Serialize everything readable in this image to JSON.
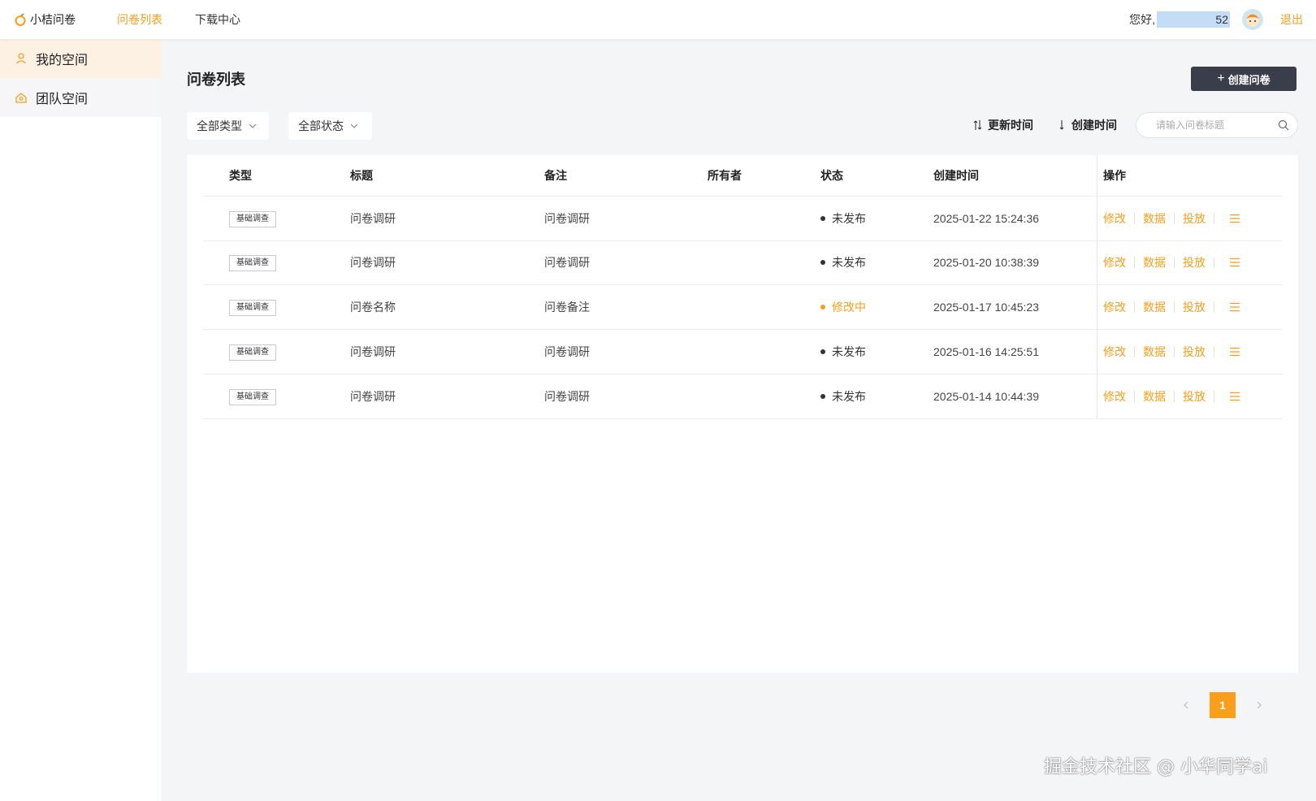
{
  "brand": {
    "name": "小桔问卷"
  },
  "nav": {
    "items": [
      {
        "label": "问卷列表",
        "active": true
      },
      {
        "label": "下载中心",
        "active": false
      }
    ]
  },
  "user": {
    "greeting": "您好,",
    "name": "52",
    "logout": "退出"
  },
  "sidebar": {
    "items": [
      {
        "label": "我的空间",
        "icon": "user-icon",
        "active": true
      },
      {
        "label": "团队空间",
        "icon": "team-icon",
        "active": false
      }
    ]
  },
  "page": {
    "title": "问卷列表",
    "create_button": "创建问卷"
  },
  "filters": {
    "type": "全部类型",
    "status": "全部状态"
  },
  "sort": {
    "updated": "更新时间",
    "created": "创建时间"
  },
  "search": {
    "placeholder": "请输入问卷标题",
    "value": ""
  },
  "table": {
    "headers": {
      "type": "类型",
      "title": "标题",
      "note": "备注",
      "owner": "所有者",
      "status": "状态",
      "created": "创建时间",
      "ops": "操作"
    },
    "ops_labels": {
      "edit": "修改",
      "data": "数据",
      "publish": "投放"
    },
    "rows": [
      {
        "type": "基础调查",
        "title": "问卷调研",
        "note": "问卷调研",
        "owner": "",
        "status": "未发布",
        "status_color": "#333333",
        "created": "2025-01-22 15:24:36"
      },
      {
        "type": "基础调查",
        "title": "问卷调研",
        "note": "问卷调研",
        "owner": "",
        "status": "未发布",
        "status_color": "#333333",
        "created": "2025-01-20 10:38:39"
      },
      {
        "type": "基础调查",
        "title": "问卷名称",
        "note": "问卷备注",
        "owner": "",
        "status": "修改中",
        "status_color": "#fa9e1b",
        "created": "2025-01-17 10:45:23"
      },
      {
        "type": "基础调查",
        "title": "问卷调研",
        "note": "问卷调研",
        "owner": "",
        "status": "未发布",
        "status_color": "#333333",
        "created": "2025-01-16 14:25:51"
      },
      {
        "type": "基础调查",
        "title": "问卷调研",
        "note": "问卷调研",
        "owner": "",
        "status": "未发布",
        "status_color": "#333333",
        "created": "2025-01-14 10:44:39"
      }
    ]
  },
  "pagination": {
    "current": "1"
  },
  "watermark": "掘金技术社区 @ 小华同学ai",
  "colors": {
    "accent": "#fa9e1b",
    "dark_button": "#3a3d4a"
  }
}
